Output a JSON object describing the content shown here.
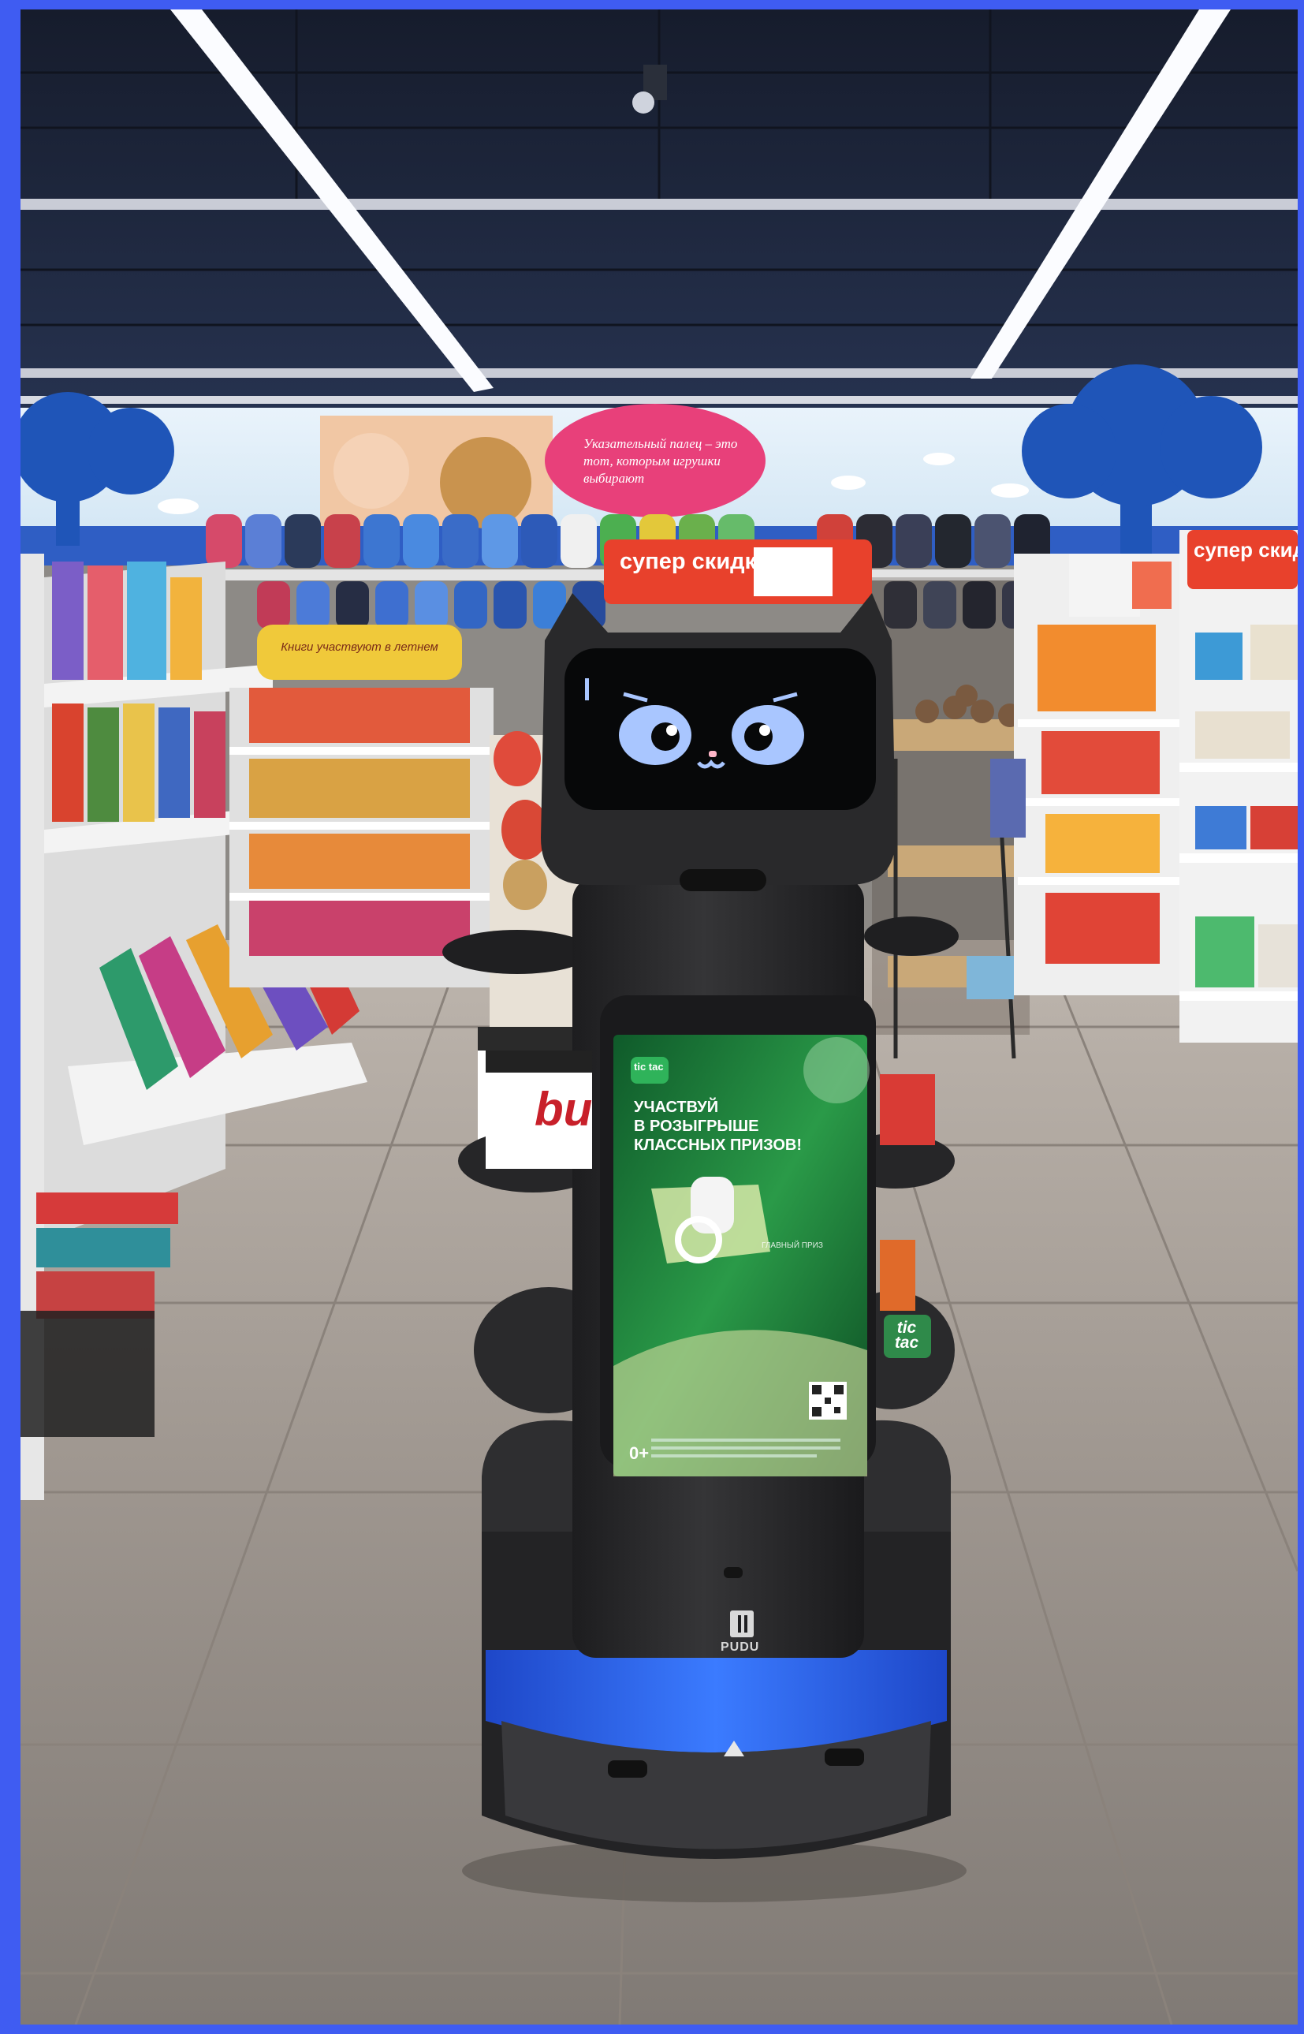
{
  "mural": {
    "caption": "Указательный палец – это тот, которым игрушки выбирают"
  },
  "shelf_signs": {
    "sale_center": "супер скидки",
    "sale_right": "супер скидки",
    "books_banner": "Книги участвуют в летнем"
  },
  "robot": {
    "brand": "PUDU",
    "face_screen": {
      "expression": "cat-face"
    },
    "promo_screen": {
      "logo": "tic tac",
      "headline_lines": [
        "УЧАСТВУЙ",
        "В РОЗЫГРЫШЕ",
        "КЛАССНЫХ ПРИЗОВ!"
      ],
      "prize_label": "ГЛАВНЫЙ ПРИЗ",
      "age_rating": "0+"
    }
  },
  "product_boxes": {
    "kinder_box": "bu",
    "tictac_pack": "tic tac"
  },
  "colors": {
    "frame_border": "#3f5cf2",
    "sale_sign": "#e8412c",
    "robot_body": "#2b2b2c",
    "robot_base_light": "#2f66e8",
    "promo_green": "#1f7a3c",
    "cat_eyes": "#a9c6ff"
  }
}
